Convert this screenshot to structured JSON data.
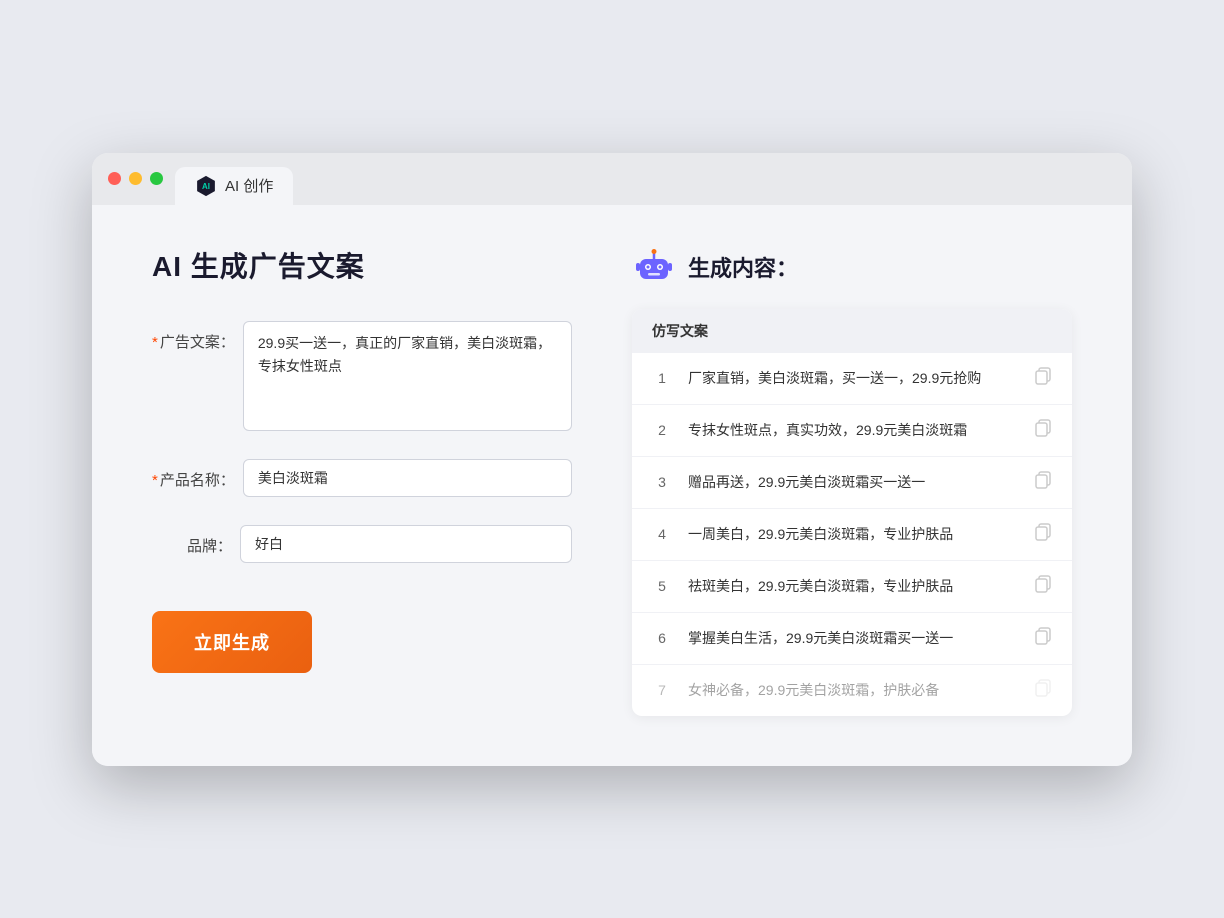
{
  "browser": {
    "tab_label": "AI 创作"
  },
  "page": {
    "title": "AI 生成广告文案",
    "form": {
      "ad_copy_label": "广告文案：",
      "ad_copy_required": "*",
      "ad_copy_value": "29.9买一送一，真正的厂家直销，美白淡斑霜，专抹女性斑点",
      "product_label": "产品名称：",
      "product_required": "*",
      "product_value": "美白淡斑霜",
      "brand_label": "品牌：",
      "brand_value": "好白",
      "generate_btn": "立即生成"
    },
    "results": {
      "icon_label": "robot-icon",
      "title": "生成内容：",
      "table_header": "仿写文案",
      "items": [
        {
          "num": "1",
          "text": "厂家直销，美白淡斑霜，买一送一，29.9元抢购",
          "muted": false
        },
        {
          "num": "2",
          "text": "专抹女性斑点，真实功效，29.9元美白淡斑霜",
          "muted": false
        },
        {
          "num": "3",
          "text": "赠品再送，29.9元美白淡斑霜买一送一",
          "muted": false
        },
        {
          "num": "4",
          "text": "一周美白，29.9元美白淡斑霜，专业护肤品",
          "muted": false
        },
        {
          "num": "5",
          "text": "祛斑美白，29.9元美白淡斑霜，专业护肤品",
          "muted": false
        },
        {
          "num": "6",
          "text": "掌握美白生活，29.9元美白淡斑霜买一送一",
          "muted": false
        },
        {
          "num": "7",
          "text": "女神必备，29.9元美白淡斑霜，护肤必备",
          "muted": true
        }
      ]
    }
  }
}
